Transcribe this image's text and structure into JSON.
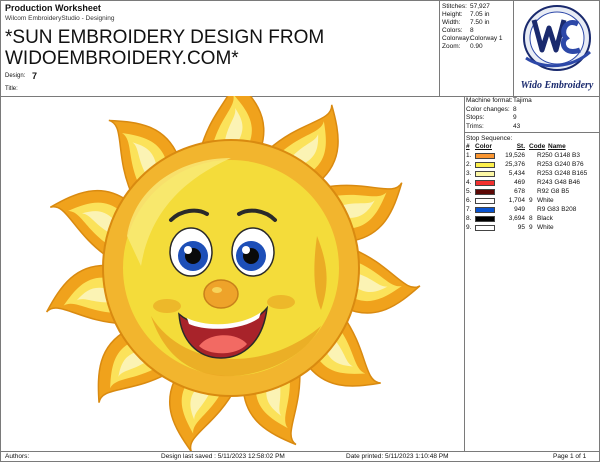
{
  "header": {
    "title": "Production Worksheet",
    "subtitle": "Wilcom EmbroideryStudio - Designing",
    "design_name_line1": "*SUN EMBROIDERY DESIGN FROM",
    "design_name_line2": "WIDOEMBROIDERY.COM*",
    "design_label": "Design:",
    "design_value": "7",
    "title_label": "Title:"
  },
  "stats": [
    {
      "key": "Stitches:",
      "value": "57,927"
    },
    {
      "key": "Height:",
      "value": "7.05 in"
    },
    {
      "key": "Width:",
      "value": "7.50 in"
    },
    {
      "key": "Colors:",
      "value": "8"
    },
    {
      "key": "Colorway:",
      "value": "Colorway 1"
    },
    {
      "key": "Zoom:",
      "value": "0.90"
    }
  ],
  "logo": {
    "text": "Wido Embroidery",
    "mark": "WE",
    "colors": {
      "ring": "#1a2a6e",
      "swoosh": "#2d48a8",
      "text": "#1a2a6e"
    }
  },
  "machine": [
    {
      "key": "Machine format:",
      "value": "Tajima"
    },
    {
      "key": "Color changes:",
      "value": "8"
    },
    {
      "key": "Stops:",
      "value": "9"
    },
    {
      "key": "Trims:",
      "value": "43"
    }
  ],
  "stop_sequence": {
    "label": "Stop Sequence:",
    "headers": {
      "num": "#",
      "color": "Color",
      "st": "St.",
      "code": "Code",
      "name": "Name"
    },
    "rows": [
      {
        "num": "1.",
        "swatch": "#fa9632",
        "st": "19,526",
        "code": "",
        "name": "R250 G148 B3"
      },
      {
        "num": "2.",
        "swatch": "#fdf04c",
        "st": "25,376",
        "code": "",
        "name": "R253 G240 B76"
      },
      {
        "num": "3.",
        "swatch": "#fdf8a5",
        "st": "5,434",
        "code": "",
        "name": "R253 G248 B165"
      },
      {
        "num": "4.",
        "swatch": "#f3302e",
        "st": "469",
        "code": "",
        "name": "R243 G48 B46"
      },
      {
        "num": "5.",
        "swatch": "#5c0805",
        "st": "678",
        "code": "",
        "name": "R92 G8 B5"
      },
      {
        "num": "6.",
        "swatch": "#ffffff",
        "st": "1,704",
        "code": "9",
        "name": "White"
      },
      {
        "num": "7.",
        "swatch": "#0953d0",
        "st": "949",
        "code": "",
        "name": "R9 G83 B208"
      },
      {
        "num": "8.",
        "swatch": "#000000",
        "st": "3,694",
        "code": "8",
        "name": "Black"
      },
      {
        "num": "9.",
        "swatch": "#ffffff",
        "st": "95",
        "code": "9",
        "name": "White"
      }
    ]
  },
  "footer": {
    "authors_label": "Authors:",
    "last_saved": "Design last saved : 5/11/2023 12:58:02 PM",
    "printed": "Date printed: 5/11/2023 1:10:48 PM",
    "page": "Page 1 of 1"
  },
  "artwork": {
    "subject": "smiling sun embroidery",
    "colors": {
      "ray_outer": "#f0a21c",
      "ray_inner": "#fbe25a",
      "ray_light": "#fbf3b4",
      "face": "#f4dc3a",
      "shade": "#e8a020",
      "mouth": "#a8232a",
      "tongue": "#f26a63",
      "iris": "#1d4fb8"
    }
  }
}
